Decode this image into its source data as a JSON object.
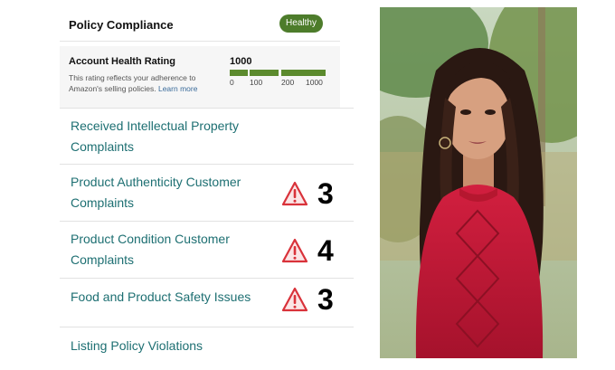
{
  "policy_compliance": {
    "title": "Policy Compliance",
    "status_badge": "Healthy"
  },
  "account_health": {
    "title": "Account Health Rating",
    "description": "This rating reflects your adherence to Amazon's selling policies.",
    "learn_more": "Learn more",
    "rating": "1000",
    "scale_ticks": [
      "0",
      "100",
      "200",
      "1000"
    ]
  },
  "rows": [
    {
      "label_line1": "Received Intellectual Property",
      "label_line2": "Complaints",
      "count": ""
    },
    {
      "label_line1": "Product Authenticity Customer",
      "label_line2": "Complaints",
      "count": "3"
    },
    {
      "label_line1": "Product Condition Customer",
      "label_line2": "Complaints",
      "count": "4"
    },
    {
      "label_line1": "Food and Product Safety Issues",
      "label_line2": "",
      "count": "3"
    },
    {
      "label_line1": "Listing Policy Violations",
      "label_line2": "",
      "count": ""
    }
  ],
  "colors": {
    "badge_green": "#4d7c2b",
    "bar_green": "#5b8a2d",
    "link_teal": "#1d6f72",
    "warning_red": "#d9323a"
  },
  "icons": {
    "warning": "warning-triangle-icon"
  }
}
